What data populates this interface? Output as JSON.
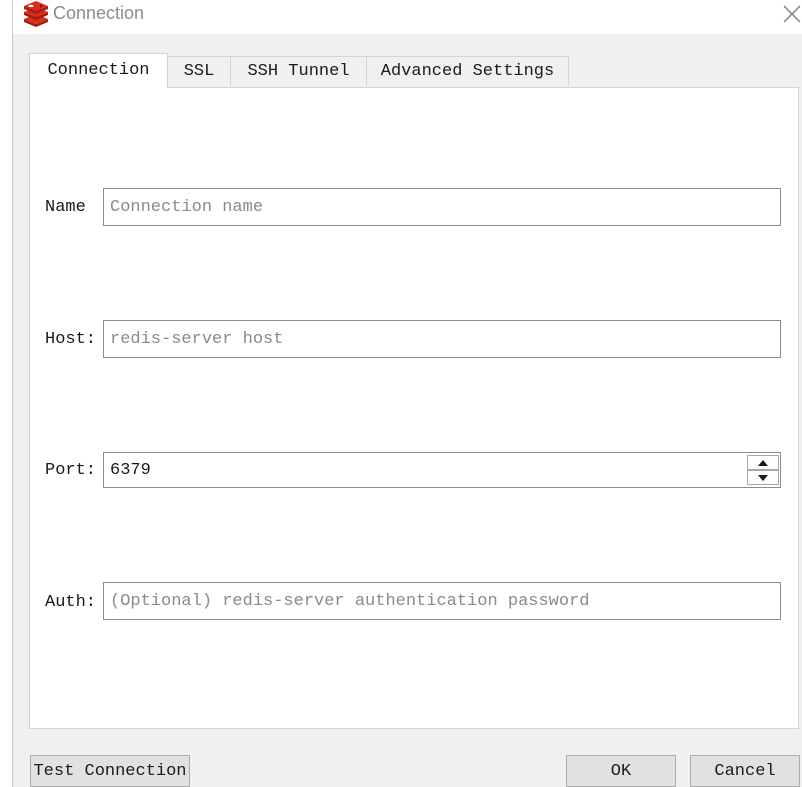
{
  "window": {
    "title": "Connection"
  },
  "tabs": [
    {
      "label": "Connection",
      "active": true
    },
    {
      "label": "SSL",
      "active": false
    },
    {
      "label": "SSH Tunnel",
      "active": false
    },
    {
      "label": "Advanced Settings",
      "active": false
    }
  ],
  "form": {
    "name": {
      "label": "Name",
      "placeholder": "Connection name",
      "value": ""
    },
    "host": {
      "label": "Host:",
      "placeholder": "redis-server host",
      "value": ""
    },
    "port": {
      "label": "Port:",
      "value": "6379"
    },
    "auth": {
      "label": "Auth:",
      "placeholder": "(Optional) redis-server authentication password",
      "value": ""
    }
  },
  "buttons": {
    "test_connection": "Test Connection",
    "ok": "OK",
    "cancel": "Cancel"
  },
  "icons": {
    "app": "redis-logo-icon",
    "close": "close-icon",
    "spin_up": "chevron-up-icon",
    "spin_down": "chevron-down-icon"
  },
  "colors": {
    "redis_red": "#d82c20",
    "dialog_bg": "#f0f0f0",
    "panel_bg": "#ffffff",
    "placeholder": "#8a8a8a"
  }
}
